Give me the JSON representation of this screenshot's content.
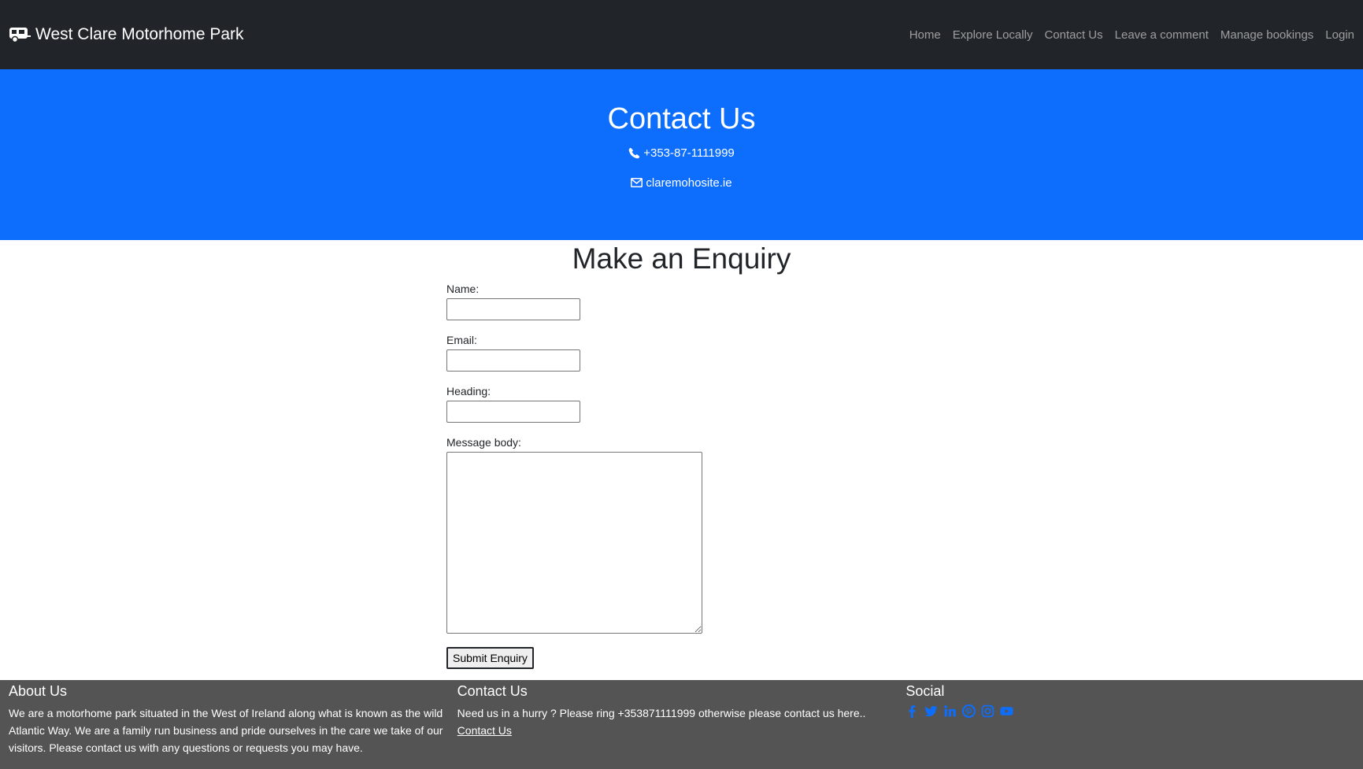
{
  "brand": {
    "title": "West Clare Motorhome Park"
  },
  "nav": {
    "items": [
      {
        "label": "Home"
      },
      {
        "label": "Explore Locally"
      },
      {
        "label": "Contact Us"
      },
      {
        "label": "Leave a comment"
      },
      {
        "label": "Manage bookings"
      },
      {
        "label": "Login"
      }
    ]
  },
  "hero": {
    "title": "Contact Us",
    "phone": "+353-87-1111999",
    "email": "claremohosite.ie"
  },
  "form": {
    "title": "Make an Enquiry",
    "name_label": "Name:",
    "email_label": "Email:",
    "heading_label": "Heading:",
    "message_label": "Message body:",
    "submit_label": "Submit Enquiry"
  },
  "footer": {
    "about_title": "About Us",
    "about_text": "We are a motorhome park situated in the West of Ireland along what is known as the wild Atlantic Way. We are a family run business and pride ourselves in the care we take of our visitors. Please contact us with any questions or requests you may have.",
    "contact_title": "Contact Us",
    "contact_text": "Need us in a hurry ? Please ring +353871111999 otherwise please contact us here..",
    "contact_link": "Contact Us",
    "social_title": "Social",
    "social_icons": [
      "facebook-icon",
      "twitter-icon",
      "linkedin-icon",
      "pinterest-icon",
      "instagram-icon",
      "youtube-icon"
    ]
  },
  "colors": {
    "navbar": "#212529",
    "hero": "#0d6efd",
    "footer": "#545454",
    "social_icon": "#0d6efd"
  }
}
